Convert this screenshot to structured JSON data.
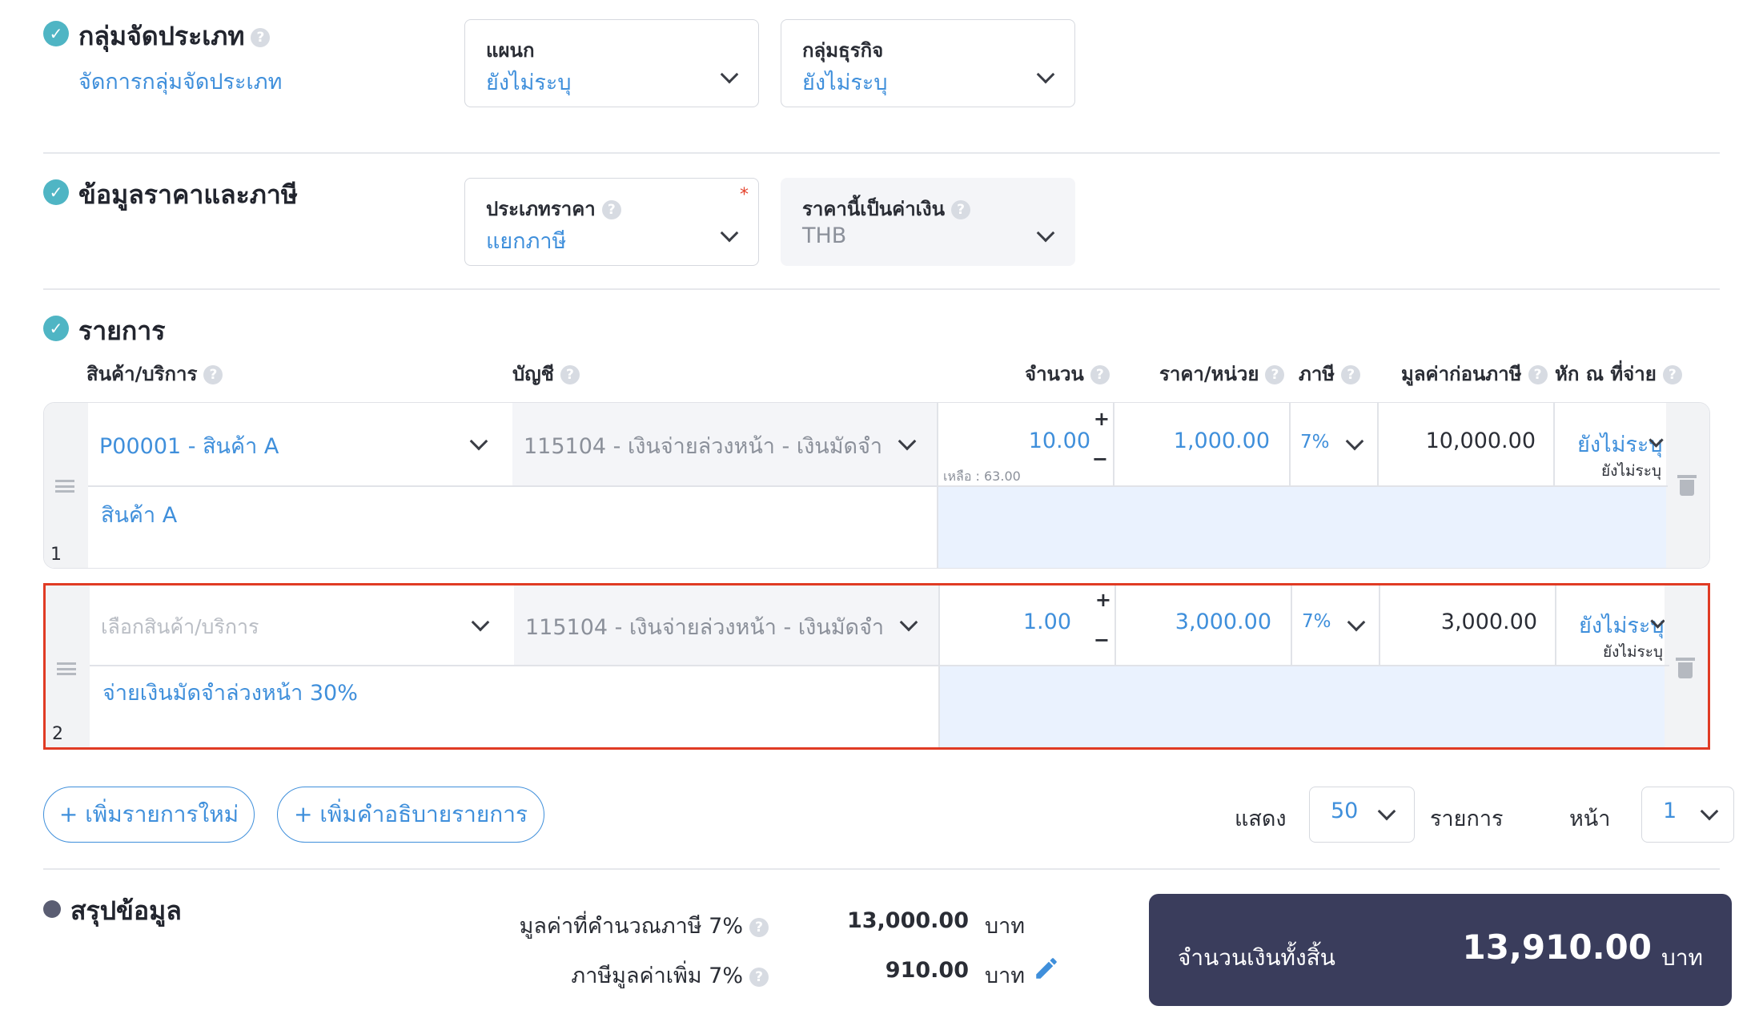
{
  "classification": {
    "title": "กลุ่มจัดประเภท",
    "manage_link": "จัดการกลุ่มจัดประเภท",
    "department": {
      "label": "แผนก",
      "value": "ยังไม่ระบุ"
    },
    "business_group": {
      "label": "กลุ่มธุรกิจ",
      "value": "ยังไม่ระบุ"
    }
  },
  "pricing": {
    "title": "ข้อมูลราคาและภาษี",
    "price_type": {
      "label": "ประเภทราคา",
      "value": "แยกภาษี",
      "required_mark": "*"
    },
    "currency": {
      "label": "ราคานี้เป็นค่าเงิน",
      "value": "THB"
    }
  },
  "items": {
    "title": "รายการ",
    "columns": {
      "product": "สินค้า/บริการ",
      "account": "บัญชี",
      "quantity": "จำนวน",
      "unit_price": "ราคา/หน่วย",
      "tax": "ภาษี",
      "pre_tax": "มูลค่าก่อนภาษี",
      "withholding": "หัก ณ ที่จ่าย"
    },
    "rows": [
      {
        "number": "1",
        "product": "P00001 - สินค้า A",
        "account": "115104 - เงินจ่ายล่วงหน้า - เงินมัดจำ",
        "quantity": "10.00",
        "remaining": "เหลือ : 63.00",
        "unit_price": "1,000.00",
        "tax": "7%",
        "pre_tax": "10,000.00",
        "withholding": "ยังไม่ระบุ",
        "withholding_sub": "ยังไม่ระบุ",
        "description": "สินค้า A"
      },
      {
        "number": "2",
        "product_placeholder": "เลือกสินค้า/บริการ",
        "account": "115104 - เงินจ่ายล่วงหน้า - เงินมัดจำ",
        "quantity": "1.00",
        "unit_price": "3,000.00",
        "tax": "7%",
        "pre_tax": "3,000.00",
        "withholding": "ยังไม่ระบุ",
        "withholding_sub": "ยังไม่ระบุ",
        "description": "จ่ายเงินมัดจำล่วงหน้า 30%"
      }
    ],
    "add_item": "+ เพิ่มรายการใหม่",
    "add_description": "+ เพิ่มคำอธิบายรายการ",
    "show_label": "แสดง",
    "page_size": "50",
    "items_label": "รายการ",
    "page_label": "หน้า",
    "page_number": "1"
  },
  "summary": {
    "title": "สรุปข้อมูล",
    "taxable_label": "มูลค่าที่คำนวณภาษี 7%",
    "taxable_value": "13,000.00",
    "vat_label": "ภาษีมูลค่าเพิ่ม 7%",
    "vat_value": "910.00",
    "currency_unit": "บาท",
    "total_label": "จำนวนเงินทั้งสิ้น",
    "total_value": "13,910.00"
  },
  "colors": {
    "accent": "#3f8fdb",
    "check": "#4fb5c4",
    "highlight_border": "#e03b24",
    "total_box": "#3a3d5c"
  },
  "icons": [
    "check-icon",
    "help-icon",
    "chevron-down-icon",
    "drag-handle-icon",
    "trash-icon",
    "pencil-icon"
  ]
}
